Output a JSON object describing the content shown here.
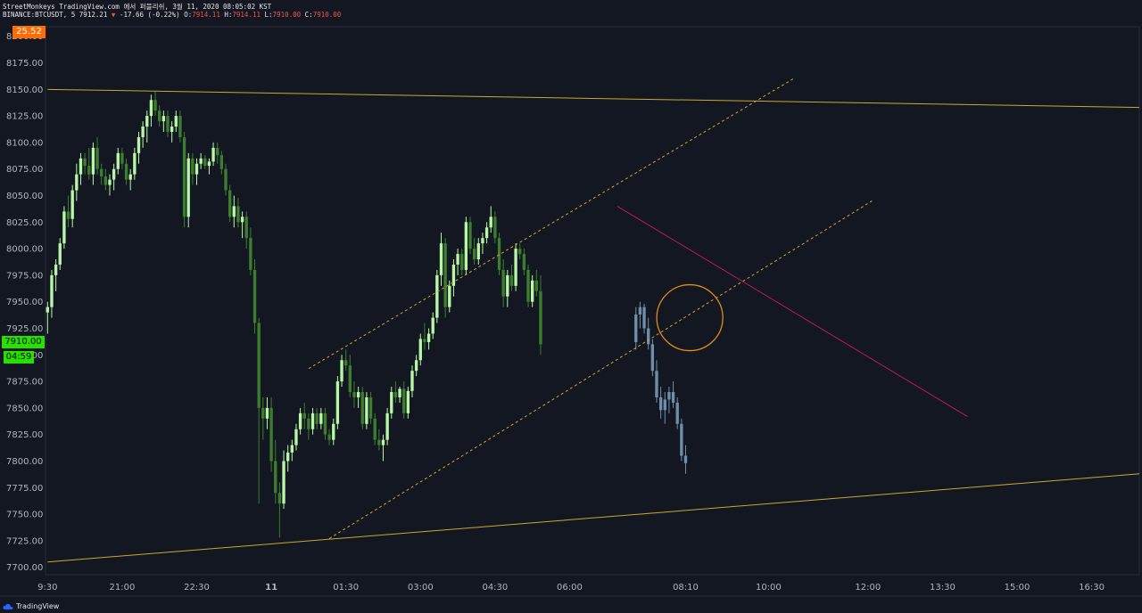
{
  "header": {
    "line1": "StreetMonkeys TradingView.com 에서 퍼블리쉬, 3월 11, 2020 08:05:02 KST",
    "symbol": "BINANCE:BTCUSDT, 5 7912.21",
    "change": "-17.66 (-0.22%)",
    "o_label": "O:",
    "o_value": "7914.11",
    "h_label": "H:",
    "h_value": "7914.11",
    "l_label": "L:",
    "l_value": "7910.00",
    "c_label": "C:",
    "c_value": "7910.00"
  },
  "tags": {
    "indicator": "25.52",
    "last_price": "7910.00",
    "countdown": "04:59"
  },
  "footer": {
    "brand": "TradingView"
  },
  "colors": {
    "background": "#131722",
    "bull": "#b9f6a8",
    "bear": "#3d7d2e",
    "projection": "#6f8fa8",
    "trendline": "#c8aa2c",
    "channel": "#c8aa2c",
    "resistance": "#c2185b",
    "circle": "#e08a1e",
    "grid": "#2a2e39",
    "axis_text": "#b2b5be"
  },
  "chart_data": {
    "type": "candlestick",
    "title": "",
    "y_ticks": [
      8200,
      8175,
      8150,
      8125,
      8100,
      8075,
      8050,
      8025,
      8000,
      7975,
      7950,
      7925,
      7900,
      7875,
      7850,
      7825,
      7800,
      7775,
      7750,
      7725,
      7700
    ],
    "y_tick_labels": [
      "8200.00",
      "8175.00",
      "8150.00",
      "8125.00",
      "8100.00",
      "8075.00",
      "8050.00",
      "8025.00",
      "8000.00",
      "7975.00",
      "7950.00",
      "7925.00",
      "7900.00",
      "7875.00",
      "7850.00",
      "7825.00",
      "7800.00",
      "7775.00",
      "7750.00",
      "7725.00",
      "7700.00"
    ],
    "ylim": [
      7693,
      8209
    ],
    "x_ticks": [
      {
        "bar": 0,
        "label": "9:30"
      },
      {
        "bar": 18,
        "label": "21:00"
      },
      {
        "bar": 36,
        "label": "22:30"
      },
      {
        "bar": 54,
        "label": "11"
      },
      {
        "bar": 72,
        "label": "01:30"
      },
      {
        "bar": 90,
        "label": "03:00"
      },
      {
        "bar": 108,
        "label": "04:30"
      },
      {
        "bar": 126,
        "label": "06:00"
      },
      {
        "bar": 154,
        "label": "08:10"
      },
      {
        "bar": 174,
        "label": "10:00"
      },
      {
        "bar": 198,
        "label": "12:00"
      },
      {
        "bar": 216,
        "label": "13:30"
      },
      {
        "bar": 234,
        "label": "15:00"
      },
      {
        "bar": 252,
        "label": "16:30"
      }
    ],
    "xlim": [
      -0.5,
      263.5
    ],
    "candles": [
      [
        7940,
        7950,
        7920,
        7945
      ],
      [
        7945,
        7980,
        7935,
        7975
      ],
      [
        7975,
        7990,
        7960,
        7985
      ],
      [
        7985,
        8010,
        7980,
        8005
      ],
      [
        8005,
        8040,
        8000,
        8035
      ],
      [
        8035,
        8050,
        8020,
        8028
      ],
      [
        8028,
        8060,
        8020,
        8055
      ],
      [
        8055,
        8080,
        8045,
        8070
      ],
      [
        8070,
        8090,
        8060,
        8085
      ],
      [
        8085,
        8090,
        8070,
        8078
      ],
      [
        8078,
        8095,
        8065,
        8070
      ],
      [
        8070,
        8100,
        8060,
        8095
      ],
      [
        8095,
        8105,
        8070,
        8075
      ],
      [
        8075,
        8080,
        8060,
        8068
      ],
      [
        8068,
        8075,
        8055,
        8060
      ],
      [
        8060,
        8070,
        8050,
        8065
      ],
      [
        8065,
        8080,
        8055,
        8075
      ],
      [
        8075,
        8095,
        8070,
        8090
      ],
      [
        8090,
        8095,
        8075,
        8080
      ],
      [
        8080,
        8085,
        8060,
        8065
      ],
      [
        8065,
        8075,
        8055,
        8070
      ],
      [
        8070,
        8095,
        8065,
        8090
      ],
      [
        8090,
        8110,
        8080,
        8105
      ],
      [
        8105,
        8120,
        8095,
        8115
      ],
      [
        8115,
        8130,
        8100,
        8125
      ],
      [
        8125,
        8145,
        8115,
        8140
      ],
      [
        8140,
        8148,
        8125,
        8130
      ],
      [
        8130,
        8135,
        8115,
        8120
      ],
      [
        8120,
        8130,
        8110,
        8125
      ],
      [
        8125,
        8130,
        8105,
        8110
      ],
      [
        8110,
        8120,
        8100,
        8115
      ],
      [
        8115,
        8130,
        8110,
        8125
      ],
      [
        8125,
        8130,
        8100,
        8105
      ],
      [
        8105,
        8110,
        8020,
        8030
      ],
      [
        8030,
        8090,
        8020,
        8085
      ],
      [
        8085,
        8090,
        8060,
        8070
      ],
      [
        8070,
        8085,
        8060,
        8080
      ],
      [
        8080,
        8090,
        8075,
        8085
      ],
      [
        8085,
        8088,
        8075,
        8078
      ],
      [
        8078,
        8085,
        8070,
        8082
      ],
      [
        8082,
        8100,
        8078,
        8095
      ],
      [
        8095,
        8100,
        8080,
        8088
      ],
      [
        8088,
        8092,
        8070,
        8075
      ],
      [
        8075,
        8080,
        8050,
        8055
      ],
      [
        8055,
        8060,
        8025,
        8030
      ],
      [
        8030,
        8050,
        8020,
        8040
      ],
      [
        8040,
        8048,
        8020,
        8025
      ],
      [
        8025,
        8035,
        8010,
        8030
      ],
      [
        8030,
        8035,
        8000,
        8010
      ],
      [
        8010,
        8020,
        7975,
        7980
      ],
      [
        7980,
        7990,
        7920,
        7930
      ],
      [
        7930,
        7935,
        7760,
        7850
      ],
      [
        7850,
        7860,
        7820,
        7840
      ],
      [
        7840,
        7860,
        7830,
        7850
      ],
      [
        7850,
        7860,
        7790,
        7800
      ],
      [
        7800,
        7820,
        7760,
        7770
      ],
      [
        7770,
        7780,
        7728,
        7760
      ],
      [
        7760,
        7810,
        7755,
        7800
      ],
      [
        7800,
        7815,
        7790,
        7808
      ],
      [
        7808,
        7820,
        7800,
        7815
      ],
      [
        7815,
        7835,
        7810,
        7830
      ],
      [
        7830,
        7850,
        7825,
        7845
      ],
      [
        7845,
        7855,
        7830,
        7840
      ],
      [
        7840,
        7845,
        7820,
        7830
      ],
      [
        7830,
        7850,
        7825,
        7845
      ],
      [
        7845,
        7850,
        7830,
        7835
      ],
      [
        7835,
        7850,
        7830,
        7845
      ],
      [
        7845,
        7850,
        7820,
        7825
      ],
      [
        7825,
        7830,
        7815,
        7820
      ],
      [
        7820,
        7840,
        7815,
        7835
      ],
      [
        7835,
        7880,
        7830,
        7875
      ],
      [
        7875,
        7900,
        7870,
        7895
      ],
      [
        7895,
        7905,
        7885,
        7890
      ],
      [
        7890,
        7900,
        7860,
        7865
      ],
      [
        7865,
        7875,
        7850,
        7860
      ],
      [
        7860,
        7870,
        7850,
        7865
      ],
      [
        7865,
        7870,
        7830,
        7835
      ],
      [
        7835,
        7865,
        7830,
        7860
      ],
      [
        7860,
        7865,
        7835,
        7840
      ],
      [
        7840,
        7845,
        7815,
        7820
      ],
      [
        7820,
        7830,
        7810,
        7815
      ],
      [
        7815,
        7825,
        7800,
        7820
      ],
      [
        7820,
        7850,
        7815,
        7845
      ],
      [
        7845,
        7870,
        7840,
        7865
      ],
      [
        7865,
        7875,
        7855,
        7860
      ],
      [
        7860,
        7870,
        7855,
        7868
      ],
      [
        7868,
        7875,
        7840,
        7845
      ],
      [
        7845,
        7870,
        7840,
        7866
      ],
      [
        7866,
        7890,
        7860,
        7885
      ],
      [
        7885,
        7900,
        7880,
        7895
      ],
      [
        7895,
        7920,
        7890,
        7915
      ],
      [
        7915,
        7930,
        7905,
        7912
      ],
      [
        7912,
        7925,
        7905,
        7920
      ],
      [
        7920,
        7940,
        7915,
        7935
      ],
      [
        7935,
        7980,
        7930,
        7975
      ],
      [
        7975,
        8015,
        7965,
        8005
      ],
      [
        8005,
        8010,
        7935,
        7945
      ],
      [
        7945,
        7970,
        7940,
        7965
      ],
      [
        7965,
        7990,
        7955,
        7985
      ],
      [
        7985,
        8000,
        7975,
        7995
      ],
      [
        7995,
        8000,
        7975,
        7980
      ],
      [
        7980,
        8030,
        7975,
        8025
      ],
      [
        8025,
        8030,
        7995,
        8000
      ],
      [
        8000,
        8010,
        7985,
        7990
      ],
      [
        7990,
        8010,
        7985,
        8005
      ],
      [
        8005,
        8015,
        7995,
        8010
      ],
      [
        8010,
        8025,
        8005,
        8020
      ],
      [
        8020,
        8040,
        8015,
        8030
      ],
      [
        8030,
        8035,
        8005,
        8010
      ],
      [
        8010,
        8015,
        7975,
        7980
      ],
      [
        7980,
        7990,
        7945,
        7955
      ],
      [
        7955,
        7980,
        7945,
        7975
      ],
      [
        7975,
        7985,
        7960,
        7965
      ],
      [
        7965,
        8005,
        7960,
        8000
      ],
      [
        8000,
        8005,
        7990,
        7995
      ],
      [
        7995,
        8000,
        7975,
        7980
      ],
      [
        7980,
        7985,
        7945,
        7950
      ],
      [
        7950,
        7975,
        7945,
        7970
      ],
      [
        7970,
        7980,
        7955,
        7960
      ],
      [
        7960,
        7975,
        7900,
        7910
      ]
    ],
    "projection": [
      [
        7912,
        7945,
        7905,
        7938
      ],
      [
        7938,
        7950,
        7925,
        7945
      ],
      [
        7945,
        7948,
        7920,
        7925
      ],
      [
        7925,
        7935,
        7905,
        7910
      ],
      [
        7910,
        7915,
        7880,
        7885
      ],
      [
        7885,
        7895,
        7855,
        7860
      ],
      [
        7860,
        7870,
        7840,
        7848
      ],
      [
        7848,
        7865,
        7835,
        7858
      ],
      [
        7858,
        7870,
        7845,
        7865
      ],
      [
        7865,
        7875,
        7850,
        7855
      ],
      [
        7855,
        7860,
        7830,
        7835
      ],
      [
        7835,
        7840,
        7800,
        7805
      ],
      [
        7805,
        7815,
        7788,
        7798
      ]
    ],
    "projection_start_bar": 142,
    "lines": [
      {
        "type": "trendline",
        "from": [
          0,
          8150
        ],
        "to": [
          263.5,
          8133
        ]
      },
      {
        "type": "trendline",
        "from": [
          0,
          7705
        ],
        "to": [
          263.5,
          7788
        ]
      },
      {
        "type": "channel",
        "from": [
          63,
          7887
        ],
        "to": [
          180,
          8160
        ]
      },
      {
        "type": "channel",
        "from": [
          68,
          7727
        ],
        "to": [
          199,
          8045
        ]
      },
      {
        "type": "resistance",
        "from": [
          137.5,
          8040
        ],
        "to": [
          222,
          7842
        ]
      }
    ],
    "circle": {
      "bar": 155,
      "price": 7935
    }
  }
}
